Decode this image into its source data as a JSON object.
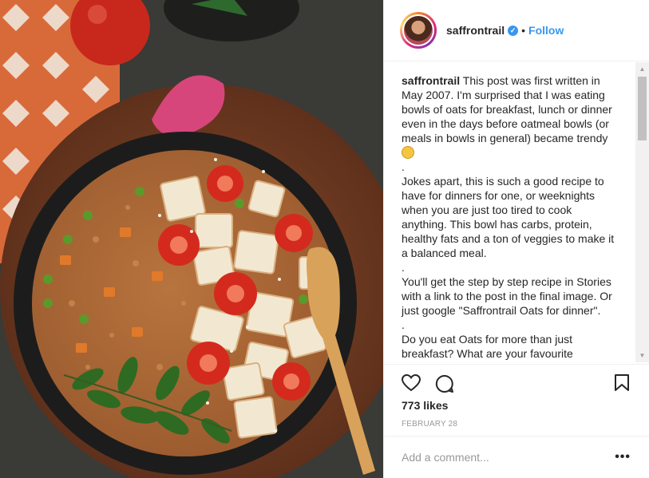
{
  "post": {
    "username": "saffrontrail",
    "verified_icon": "check-badge-icon",
    "dot": "•",
    "follow_label": "Follow",
    "caption_user": "saffrontrail",
    "caption_p1": " This post was first written in May 2007. I'm surprised that I was eating bowls of oats for breakfast, lunch or dinner even in the days before oatmeal bowls (or meals in bowls in general) became trendy ",
    "caption_p1_tail": "\n.\nJokes apart, this is such a good recipe to have for dinners for one, or weeknights when you are just too tired to cook anything. This bowl has carbs, protein, healthy fats and a ton of veggies to make it a balanced meal.\n.\nYou'll get the step by step recipe in Stories with a link to the post in the final image. Or just google \"Saffrontrail Oats for dinner\".\n.\nDo you eat Oats for more than just breakfast? What are your favourite recipes?",
    "likes": "773 likes",
    "date": "FEBRUARY 28",
    "comment_placeholder": "Add a comment...",
    "more_label": "•••"
  },
  "icons": {
    "like": "heart-icon",
    "comment": "comment-bubble-icon",
    "save": "bookmark-icon",
    "emoji": "nerd-face-emoji-icon"
  },
  "colors": {
    "link": "#3897f0",
    "text": "#262626",
    "muted": "#999999",
    "border": "#efefef"
  }
}
